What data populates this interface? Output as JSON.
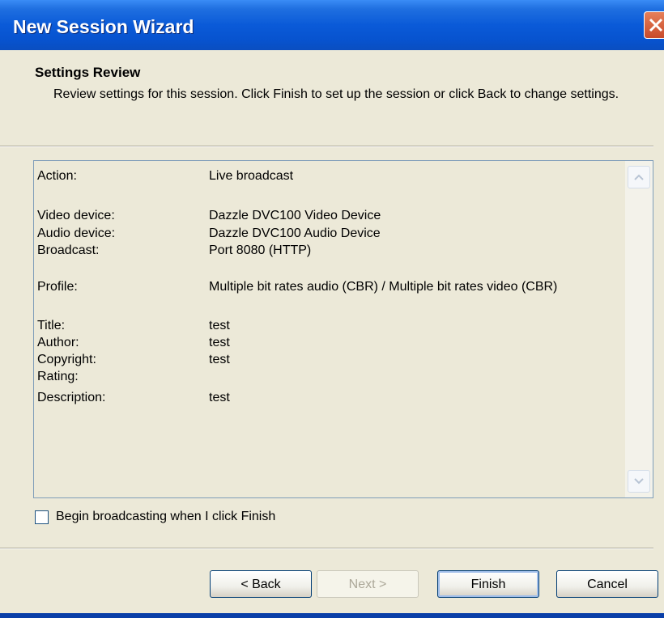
{
  "window": {
    "title": "New Session Wizard"
  },
  "header": {
    "title": "Settings Review",
    "description": "Review settings for this session. Click Finish to set up the session or click Back to change settings."
  },
  "settings": [
    {
      "label": "Action:",
      "value": "Live broadcast"
    },
    {
      "label": "Video device:",
      "value": "Dazzle DVC100 Video Device"
    },
    {
      "label": "Audio device:",
      "value": "Dazzle DVC100 Audio Device"
    },
    {
      "label": "Broadcast:",
      "value": "Port 8080 (HTTP)"
    },
    {
      "label": "Profile:",
      "value": "Multiple bit rates audio (CBR) / Multiple bit rates video (CBR)"
    },
    {
      "label": "Title:",
      "value": "test"
    },
    {
      "label": "Author:",
      "value": "test"
    },
    {
      "label": "Copyright:",
      "value": "test"
    },
    {
      "label": "Rating:",
      "value": ""
    },
    {
      "label": "Description:",
      "value": "test"
    }
  ],
  "options": {
    "begin_broadcasting_label": "Begin broadcasting when I click Finish",
    "begin_broadcasting_checked": false
  },
  "buttons": {
    "back": "< Back",
    "next": "Next >",
    "finish": "Finish",
    "cancel": "Cancel"
  },
  "icons": {
    "close": "close-icon",
    "scroll_up": "chevron-up-icon",
    "scroll_down": "chevron-down-icon"
  },
  "colors": {
    "titlebar": "#0a5ad8",
    "dialog_bg": "#ece9d8",
    "close_button": "#c84a2a"
  }
}
